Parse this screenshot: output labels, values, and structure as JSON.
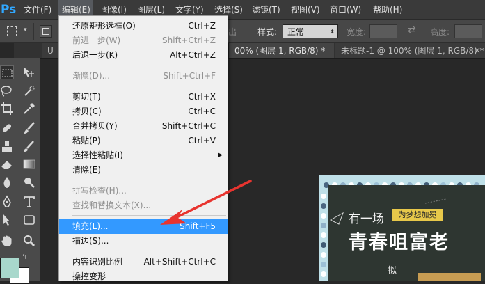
{
  "app": {
    "logo": "Ps"
  },
  "menubar": [
    "文件(F)",
    "编辑(E)",
    "图像(I)",
    "图层(L)",
    "文字(Y)",
    "选择(S)",
    "滤镜(T)",
    "视图(V)",
    "窗口(W)",
    "帮助(H)"
  ],
  "options": {
    "partial_text": "出",
    "style_label": "样式:",
    "style_value": "正常",
    "width_label": "宽度:",
    "height_label": "高度:"
  },
  "tabs": [
    {
      "label": "U"
    },
    {
      "label": "00% (图层 1, RGB/8) *"
    },
    {
      "label": "未标题-1 @ 100% (图层 1, RGB/8) *"
    }
  ],
  "edit_menu": [
    {
      "label": "还原矩形选框(O)",
      "shortcut": "Ctrl+Z",
      "disabled": false
    },
    {
      "label": "前进一步(W)",
      "shortcut": "Shift+Ctrl+Z",
      "disabled": true
    },
    {
      "label": "后退一步(K)",
      "shortcut": "Alt+Ctrl+Z",
      "disabled": false
    },
    {
      "label": "渐隐(D)...",
      "shortcut": "Shift+Ctrl+F",
      "disabled": true
    },
    {
      "label": "剪切(T)",
      "shortcut": "Ctrl+X",
      "disabled": false
    },
    {
      "label": "拷贝(C)",
      "shortcut": "Ctrl+C",
      "disabled": false
    },
    {
      "label": "合并拷贝(Y)",
      "shortcut": "Shift+Ctrl+C",
      "disabled": false
    },
    {
      "label": "粘贴(P)",
      "shortcut": "Ctrl+V",
      "disabled": false
    },
    {
      "label": "选择性粘贴(I)",
      "shortcut": "",
      "disabled": false,
      "submenu": true
    },
    {
      "label": "清除(E)",
      "shortcut": "",
      "disabled": false
    },
    {
      "label": "拼写检查(H)...",
      "shortcut": "",
      "disabled": true
    },
    {
      "label": "查找和替换文本(X)...",
      "shortcut": "",
      "disabled": true
    },
    {
      "label": "填充(L)...",
      "shortcut": "Shift+F5",
      "disabled": false,
      "highlighted": true
    },
    {
      "label": "描边(S)...",
      "shortcut": "",
      "disabled": false
    },
    {
      "label": "内容识别比例",
      "shortcut": "Alt+Shift+Ctrl+C",
      "disabled": false
    },
    {
      "label": "操控变形",
      "shortcut": "",
      "disabled": false
    }
  ],
  "canvas_image": {
    "line1": "有一场",
    "tag": "为梦想加冕",
    "line2": "青春咀富老",
    "line3": "拟"
  },
  "colors": {
    "menubar_bg": "#3a3a3a",
    "menu_highlight": "#3399ff",
    "annotation_arrow": "#e8342f",
    "foreground_swatch": "#a8d8cc",
    "background_swatch": "#ffffff",
    "ps_blue": "#31a8ff"
  }
}
